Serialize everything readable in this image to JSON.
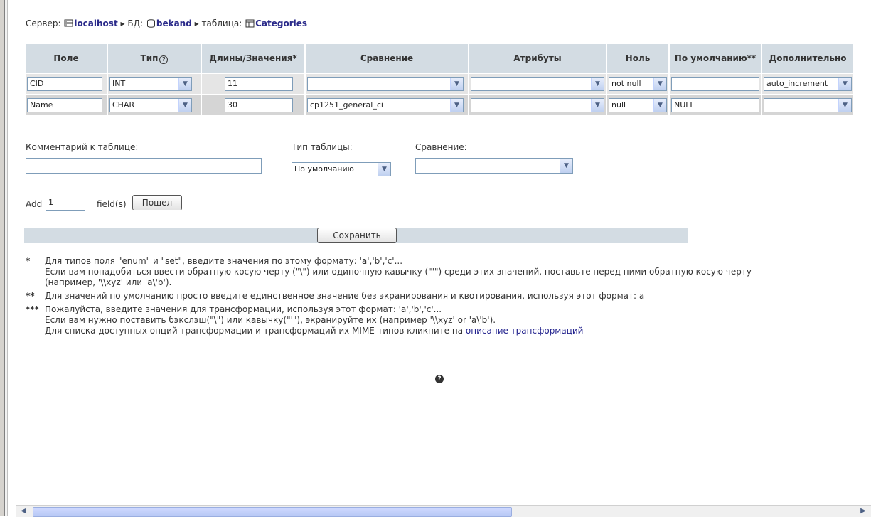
{
  "breadcrumb": {
    "server_label": "Сервер:",
    "server": "localhost",
    "sep1": "▸",
    "db_label": "БД:",
    "db": "bekand",
    "sep2": "▸",
    "table_label": "таблица:",
    "table": "Categories"
  },
  "columns": {
    "field": "Поле",
    "type": "Тип",
    "length": "Длины/Значения*",
    "collation": "Сравнение",
    "attributes": "Атрибуты",
    "null": "Ноль",
    "default": "По умолчанию**",
    "extra": "Дополнительно"
  },
  "rows": [
    {
      "field": "CID",
      "type": "INT",
      "length": "11",
      "collation": "",
      "attributes": "",
      "null": "not null",
      "default": "",
      "extra": "auto_increment"
    },
    {
      "field": "Name",
      "type": "CHAR",
      "length": "30",
      "collation": "cp1251_general_ci",
      "attributes": "",
      "null": "null",
      "default": "NULL",
      "extra": ""
    }
  ],
  "table_options": {
    "comment_label": "Комментарий к таблице:",
    "comment_value": "",
    "type_label": "Тип таблицы:",
    "type_value": "По умолчанию",
    "collation_label": "Сравнение:",
    "collation_value": ""
  },
  "add_fields": {
    "add_label": "Add",
    "count": "1",
    "fields_label": "field(s)",
    "go_button": "Пошел"
  },
  "save_button": "Сохранить",
  "notes": {
    "n1_star": "*",
    "n1_line1": "Для типов поля \"enum\" и \"set\", введите значения по этому формату: 'a','b','c'...",
    "n1_line2": "Если вам понадобиться ввести обратную косую черту (\"\\\") или одиночную кавычку (\"'\") среди этих значений, поставьте перед ними обратную косую черту",
    "n1_line3": "(например, '\\\\xyz' или 'a\\'b').",
    "n2_star": "**",
    "n2_line1": "Для значений по умолчанию просто введите единственное значение без экранирования и квотирования, используя этот формат: a",
    "n3_star": "***",
    "n3_line1": "Пожалуйста, введите значения для трансформации, используя этот формат: 'a','b','c'...",
    "n3_line2": "Если вам нужно поставить бэкслэш(\"\\\") или кавычку(\"'\"), экранируйте их (например '\\\\xyz' or 'a\\'b').",
    "n3_line3_prefix": "Для списка доступных опций трансформации и трансформаций их MIME-типов кликните на",
    "n3_link": "описание трансформаций"
  },
  "icons": {
    "dropdown": "chevron-down-icon",
    "help": "question-icon"
  }
}
